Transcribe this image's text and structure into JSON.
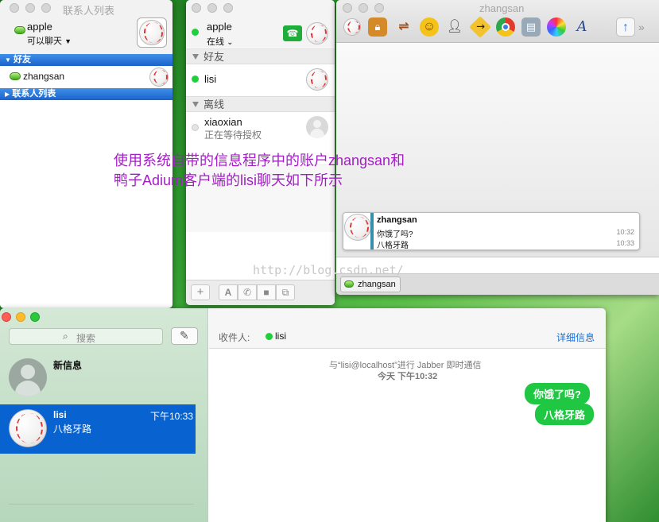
{
  "adium_contacts": {
    "title": "联系人列表",
    "account": {
      "name": "apple",
      "status": "可以聊天"
    },
    "groups": [
      {
        "label": "好友"
      },
      {
        "label": "联系人列表"
      }
    ],
    "contacts": [
      {
        "name": "zhangsan"
      }
    ]
  },
  "messages_buddy": {
    "account": {
      "name": "apple",
      "status": "在线"
    },
    "sections": [
      {
        "label": "好友"
      },
      {
        "label": "离线"
      }
    ],
    "contacts": [
      {
        "name": "lisi"
      },
      {
        "name": "xiaoxian",
        "status": "正在等待授权"
      }
    ],
    "bottom_icons": [
      "add-icon",
      "text-icon",
      "phone-icon",
      "video-icon",
      "screen-share-icon"
    ]
  },
  "adium_chat": {
    "title": "zhangsan",
    "toolbar_icons": [
      "avatar-menu-icon",
      "lock-icon",
      "signpost-icon",
      "smiley-icon",
      "block-user-icon",
      "arrow-sign-icon",
      "chrome-icon",
      "contact-card-icon",
      "color-picker-icon",
      "font-icon",
      "send-file-icon",
      "more-chevron-icon"
    ],
    "message": {
      "sender": "zhangsan",
      "lines": [
        {
          "text": "你饿了吗?",
          "time": "10:32"
        },
        {
          "text": "八格牙路",
          "time": "10:33"
        }
      ]
    },
    "tab": {
      "label": "zhangsan"
    }
  },
  "overlay": {
    "line1": "使用系统自带的信息程序中的账户zhangsan和",
    "line2": "鸭子Adium客户端的lisi聊天如下所示"
  },
  "watermark": "http://blog.csdn.net/",
  "messages_app": {
    "search_placeholder": "搜索",
    "conversations": [
      {
        "name": "新信息",
        "preview": "",
        "time": ""
      },
      {
        "name": "lisi",
        "preview": "八格牙路",
        "time": "下午10:33"
      }
    ],
    "header": {
      "to_label": "收件人:",
      "recipient": "lisi",
      "details": "详细信息"
    },
    "info_line1": "与“lisi@localhost”进行 Jabber 即时通信",
    "info_line2": "今天 下午10:32",
    "bubbles": [
      {
        "text": "你饿了吗?"
      },
      {
        "text": "八格牙路"
      }
    ]
  },
  "colors": {
    "selection": "#0862d0",
    "bubble_green": "#1fc743",
    "overlay_text": "#a41ec6",
    "adium_blue": "#1b63cb"
  }
}
